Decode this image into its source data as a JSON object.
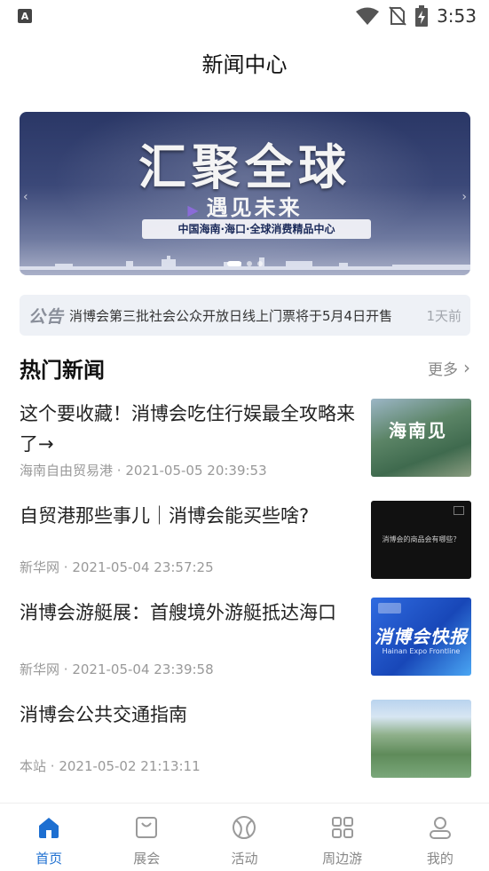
{
  "status_bar": {
    "time": "3:53",
    "app_badge": "A"
  },
  "header": {
    "title": "新闻中心"
  },
  "banner": {
    "headline": "汇聚全球",
    "subline": "遇见未来",
    "tagline": "中国海南·海口·全球消费精品中心"
  },
  "notice": {
    "badge": "公告",
    "text": "消博会第三批社会公众开放日线上门票将于5月4日开售",
    "time": "1天前"
  },
  "hot_news": {
    "title": "热门新闻",
    "more_label": "更多",
    "items": [
      {
        "title": "这个要收藏！消博会吃住行娱最全攻略来了→",
        "source": "海南自由贸易港",
        "datetime": "2021-05-05 20:39:53",
        "thumb_text": "海南见"
      },
      {
        "title": "自贸港那些事儿｜消博会能买些啥?",
        "source": "新华网",
        "datetime": "2021-05-04 23:57:25",
        "thumb_text": "消博会的商品会有哪些？"
      },
      {
        "title": "消博会游艇展：首艘境外游艇抵达海口",
        "source": "新华网",
        "datetime": "2021-05-04 23:39:58",
        "thumb_text": "消博会快报",
        "thumb_sub": "Hainan Expo Frontline"
      },
      {
        "title": "消博会公共交通指南",
        "source": "本站",
        "datetime": "2021-05-02 21:13:11"
      }
    ]
  },
  "tabbar": {
    "tabs": [
      {
        "label": "首页",
        "icon": "home-icon",
        "active": true
      },
      {
        "label": "展会",
        "icon": "bag-icon",
        "active": false
      },
      {
        "label": "活动",
        "icon": "ball-icon",
        "active": false
      },
      {
        "label": "周边游",
        "icon": "grid-icon",
        "active": false
      },
      {
        "label": "我的",
        "icon": "user-icon",
        "active": false
      }
    ]
  },
  "colors": {
    "accent": "#1d6fd1",
    "muted": "#999999",
    "notice_bg": "#eef1f6"
  }
}
